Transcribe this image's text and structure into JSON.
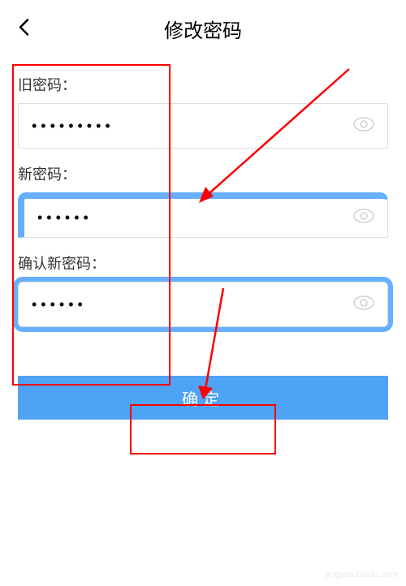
{
  "header": {
    "title": "修改密码"
  },
  "form": {
    "oldPassword": {
      "label": "旧密码：",
      "value": "•••••••••"
    },
    "newPassword": {
      "label": "新密码：",
      "value": "••••••"
    },
    "confirmPassword": {
      "label": "确认新密码：",
      "value": "••••••"
    }
  },
  "button": {
    "confirm": "确定"
  },
  "watermark": "jingyan.baidu.com"
}
